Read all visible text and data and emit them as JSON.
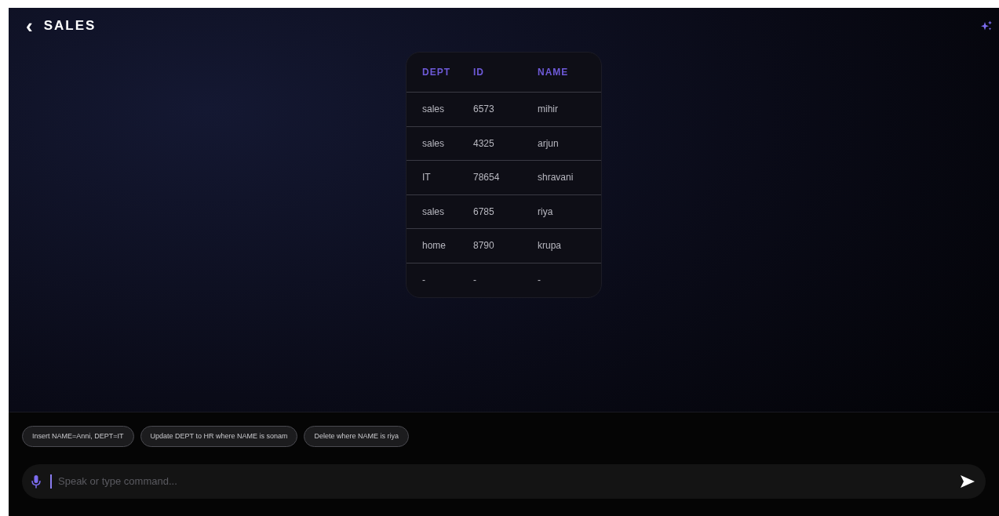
{
  "header": {
    "back": "‹",
    "title": "SALES"
  },
  "table": {
    "columns": [
      "DEPT",
      "ID",
      "NAME"
    ],
    "rows": [
      [
        "sales",
        "6573",
        "mihir"
      ],
      [
        "sales",
        "4325",
        "arjun"
      ],
      [
        "IT",
        "78654",
        "shravani"
      ],
      [
        "sales",
        "6785",
        "riya"
      ],
      [
        "home",
        "8790",
        "krupa"
      ],
      [
        "-",
        "-",
        "-"
      ]
    ]
  },
  "suggestions": [
    "Insert NAME=Anni, DEPT=IT",
    "Update DEPT to HR where NAME is sonam",
    "Delete where NAME is riya"
  ],
  "command": {
    "placeholder": "Speak or type command..."
  }
}
